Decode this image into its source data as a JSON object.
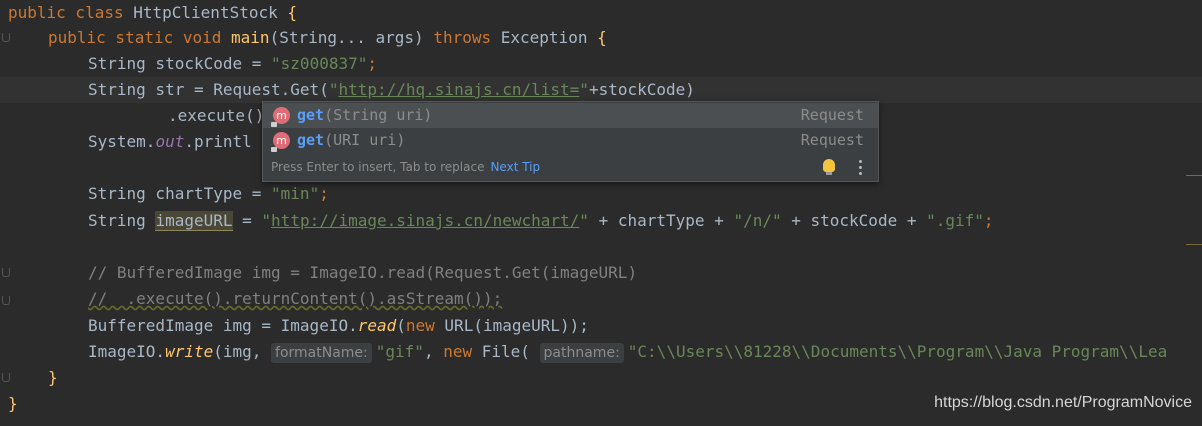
{
  "editor": {
    "lines": [
      {
        "segs": [
          [
            "kw",
            "public class "
          ],
          [
            "plain",
            "HttpClientStock "
          ],
          [
            "meth-brace",
            "{"
          ]
        ]
      },
      {
        "segs": [
          [
            "kw",
            "public static void "
          ],
          [
            "meth",
            "main"
          ],
          [
            "plain",
            "(String... args) "
          ],
          [
            "kw",
            "throws "
          ],
          [
            "plain",
            "Exception "
          ],
          [
            "meth-brace",
            "{"
          ]
        ]
      }
    ]
  },
  "code": {
    "l1_kw": "public class ",
    "l1_name": "HttpClientStock ",
    "l1_brace": "{",
    "l2_kw": "public static void ",
    "l2_main": "main",
    "l2_args": "(String... args) ",
    "l2_throws": "throws ",
    "l2_exc": "Exception ",
    "l2_brace": "{",
    "l3_decl": "String stockCode = ",
    "l3_val": "\"sz000837\"",
    "l3_semi": ";",
    "l4_decl": "String str = Request.Get(",
    "l4_q1": "\"",
    "l4_url": "http://hq.sinajs.cn/list=",
    "l4_q2": "\"",
    "l4_rest": "+stockCode)",
    "l5_exec": ".execute()",
    "l6_sys": "System.",
    "l6_out": "out",
    "l6_print": ".printl",
    "l7_decl": "String chartType = ",
    "l7_val": "\"min\"",
    "l7_semi": ";",
    "l8_decl": "String ",
    "l8_var": "imageURL",
    "l8_eq": " = ",
    "l8_q1": "\"",
    "l8_url": "http://image.sinajs.cn/newchart/",
    "l8_q2": "\"",
    "l8_p1": " + chartType + ",
    "l8_s1": "\"/n/\"",
    "l8_p2": " + stockCode + ",
    "l8_s2": "\".gif\"",
    "l8_semi": ";",
    "l9_comment": "// BufferedImage img = ImageIO.read(Request.Get(imageURL)",
    "l10_comment": "//  .execute().returnContent().asStream());",
    "l11_a": "BufferedImage img = ImageIO.",
    "l11_read": "read",
    "l11_b": "(",
    "l11_new": "new ",
    "l11_c": "URL(imageURL));",
    "l12_a": "ImageIO.",
    "l12_write": "write",
    "l12_b": "(img, ",
    "l12_hint1": "formatName:",
    "l12_s1": "\"gif\"",
    "l12_c": ", ",
    "l12_new": "new ",
    "l12_d": "File( ",
    "l12_hint2": "pathname:",
    "l12_s2": "\"C:\\\\Users\\\\81228\\\\Documents\\\\Program\\\\Java Program\\\\Lea",
    "l13_brace": "}",
    "l14_brace": "}"
  },
  "popup": {
    "items": [
      {
        "name": "get",
        "params": "(String uri)",
        "type": "Request",
        "icon": "method-icon"
      },
      {
        "name": "get",
        "params": "(URI uri)",
        "type": "Request",
        "icon": "method-icon"
      }
    ],
    "footer_text": "Press Enter to insert, Tab to replace",
    "next_tip": "Next Tip",
    "icon_letter": "m"
  },
  "watermark": "https://blog.csdn.net/ProgramNovice",
  "colors": {
    "background": "#2b2b2b",
    "keyword": "#cc7832",
    "string": "#6a8759",
    "comment": "#808080",
    "method": "#ffc66d",
    "static_field": "#9876aa",
    "popup_bg": "#3c3f41",
    "popup_highlight": "#589df6"
  }
}
